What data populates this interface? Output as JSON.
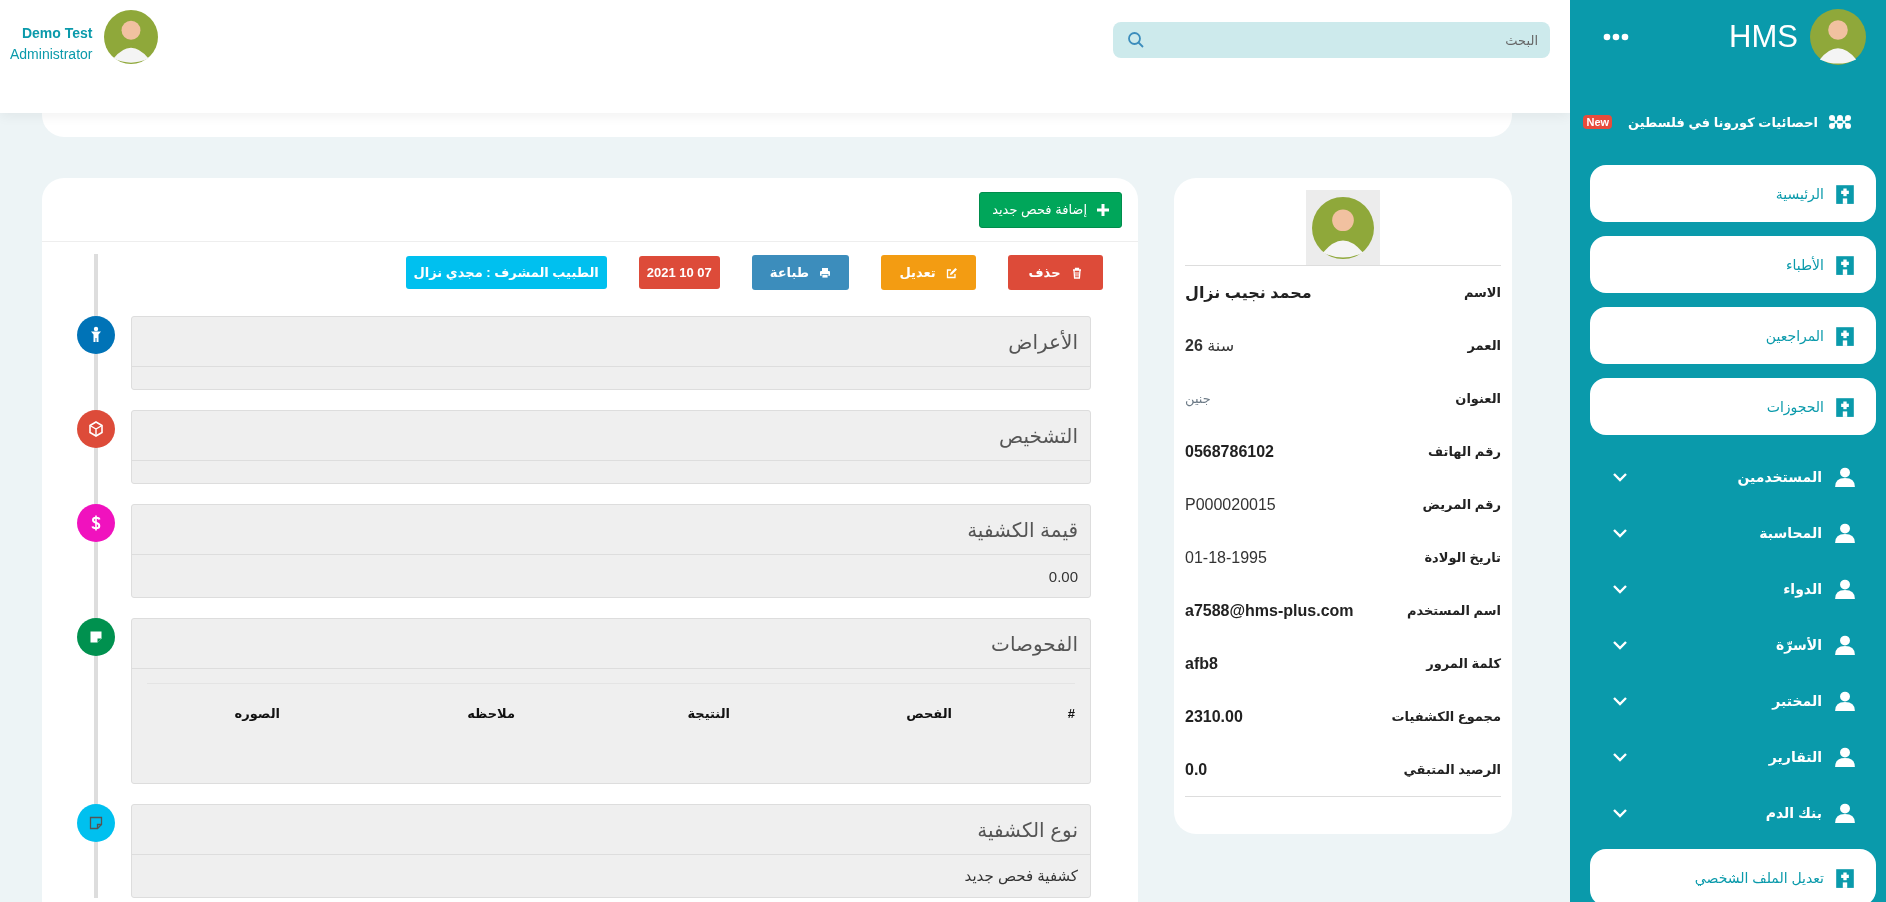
{
  "header": {
    "search": {
      "placeholder": "البحث"
    },
    "user": {
      "name": "Demo Test",
      "role": "Administrator"
    }
  },
  "sidebar": {
    "brand": "HMS",
    "promo": {
      "label": "احصائيات كورونا في فلسطين",
      "badge": "New"
    },
    "items": [
      {
        "kind": "card",
        "label": "الرئيسية"
      },
      {
        "kind": "card",
        "label": "الأطباء"
      },
      {
        "kind": "card",
        "label": "المراجعين"
      },
      {
        "kind": "card",
        "label": "الحجوزات"
      },
      {
        "kind": "group",
        "label": "المستخدمين",
        "expanded": false
      },
      {
        "kind": "group",
        "label": "المحاسبة",
        "expanded": false
      },
      {
        "kind": "group",
        "label": "الدواء",
        "expanded": false
      },
      {
        "kind": "group",
        "label": "الأسرّة",
        "expanded": false
      },
      {
        "kind": "group",
        "label": "المختبر",
        "expanded": false
      },
      {
        "kind": "group",
        "label": "التقارير",
        "expanded": false
      },
      {
        "kind": "group",
        "label": "بنك الدم",
        "expanded": false
      },
      {
        "kind": "card",
        "label": "تعديل الملف الشخصي"
      }
    ]
  },
  "patient": {
    "fields": [
      {
        "label": "الاسم",
        "value": "محمد نجيب نزال",
        "bold": true
      },
      {
        "label": "العمر",
        "value": "سنة **26**",
        "bold": false
      },
      {
        "label": "العنوان",
        "value": "جنين",
        "bold": false,
        "muted": true
      },
      {
        "label": "رقم الهاتف",
        "value": "0568786102",
        "bold": true
      },
      {
        "label": "رقم المريض",
        "value": "P000020015",
        "bold": false
      },
      {
        "label": "تاريخ الولادة",
        "value": "01-18-1995",
        "bold": false
      },
      {
        "label": "اسم المستخدم",
        "value": "a7588@hms-plus.com",
        "bold": true
      },
      {
        "label": "كلمة المرور",
        "value": "afb8",
        "bold": true
      },
      {
        "label": "مجموع الكشفيات",
        "value": "2310.00",
        "bold": true
      },
      {
        "label": "الرصيد المتبقي",
        "value": "0.0",
        "bold": true
      }
    ]
  },
  "visit": {
    "add_button": "إضافة فحص جديد",
    "actions": [
      {
        "kind": "button",
        "label": "حذف",
        "color": "#dd4b39"
      },
      {
        "kind": "button",
        "label": "تعديل",
        "color": "#f39c12"
      },
      {
        "kind": "button",
        "label": "طباعة",
        "color": "#3c8dbc"
      },
      {
        "kind": "badge",
        "label": "2021 10 07",
        "color": "#dd4b39"
      },
      {
        "kind": "badge",
        "label": "الطبيب المشرف : مجدي نزال",
        "color": "#00c0ef"
      }
    ],
    "sections": [
      {
        "title": "الأعراض",
        "color": "#0073b7",
        "kind": "empty"
      },
      {
        "title": "التشخيص",
        "color": "#dd4b39",
        "kind": "empty"
      },
      {
        "title": "قيمة الكشفية",
        "color": "#f012be",
        "kind": "text",
        "text": "0.00"
      },
      {
        "title": "الفحوصات",
        "color": "#00914f",
        "kind": "table",
        "columns": [
          "#",
          "الفحص",
          "النتيجة",
          "ملاحظه",
          "الصوره"
        ]
      },
      {
        "title": "نوع الكشفية",
        "color": "#00c0ef",
        "kind": "text",
        "text": "كشفية فحص جديد"
      }
    ]
  }
}
